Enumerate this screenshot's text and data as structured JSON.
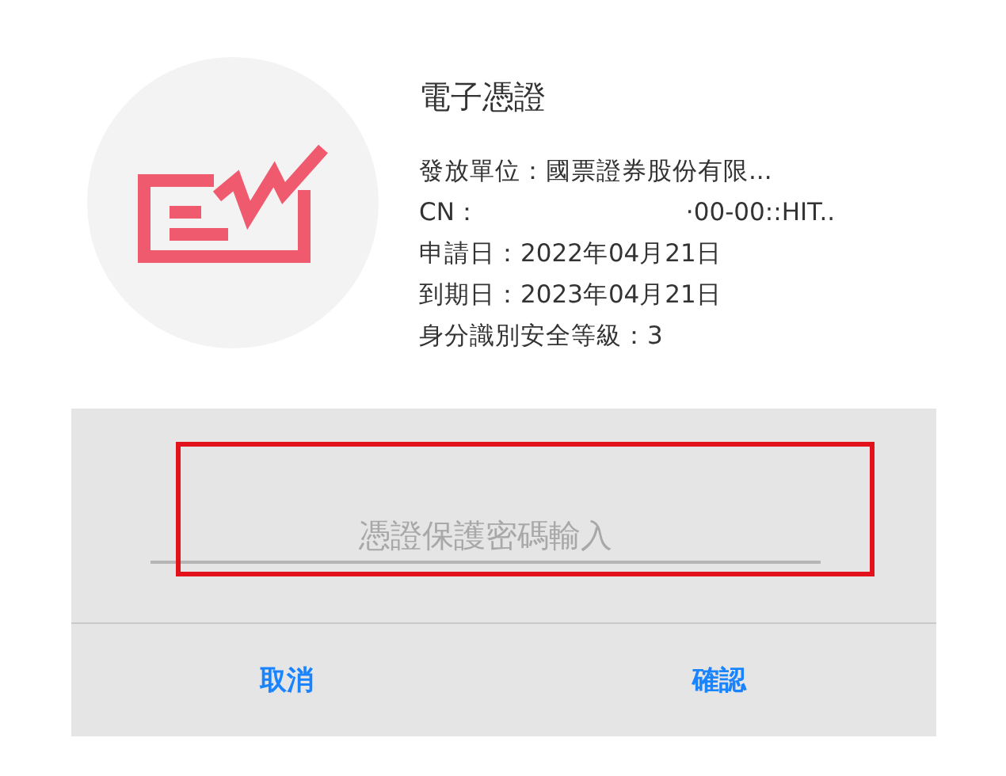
{
  "certificate": {
    "title": "電子憑證",
    "details": [
      {
        "kind": "line",
        "text": "發放單位：國票證券股份有限..."
      },
      {
        "kind": "cn",
        "label": "CN：",
        "value": "·00-00::HIT.."
      },
      {
        "kind": "line",
        "text": "申請日：2022年04月21日"
      },
      {
        "kind": "line",
        "text": "到期日：2023年04月21日"
      },
      {
        "kind": "line",
        "text": "身分識別安全等級：3"
      }
    ]
  },
  "password_field": {
    "placeholder": "憑證保護密碼輸入",
    "highlighted": true
  },
  "buttons": [
    "取消",
    "確認"
  ]
}
